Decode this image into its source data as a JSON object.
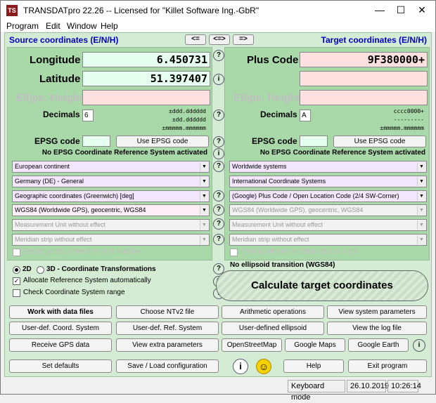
{
  "window": {
    "icon_text": "TS",
    "title": "TRANSDATpro 22.26 -- Licensed for \"Killet Software Ing.-GbR\"",
    "minimize": "—",
    "maximize": "☐",
    "close": "✕"
  },
  "menu": [
    "Program",
    "Edit",
    "Window",
    "Help"
  ],
  "headers": {
    "source": "Source coordinates (E/N/H)",
    "target": "Target coordinates (E/N/H)",
    "arrow_left": "<=",
    "arrow_both": "<=>",
    "arrow_right": "=>"
  },
  "source": {
    "longitude_label": "Longitude",
    "longitude_value": "6.450731",
    "latitude_label": "Latitude",
    "latitude_value": "51.397407",
    "ellips_label": "Ellips. Height",
    "ellips_value": "",
    "decimals_label": "Decimals",
    "decimals_value": "6",
    "format_line1": "±ddd.dddddd",
    "format_line2": "±dd.dddddd",
    "format_line3": "±mmmmm.mmmmmm",
    "epsg_label": "EPSG code",
    "epsg_button": "Use EPSG code",
    "epsg_status": "No EPSG Coordinate Reference System activated",
    "combos": [
      "European continent",
      "Germany (DE) - General",
      "Geographic coordinates (Greenwich) [deg]",
      "WGS84 (Worldwide GPS), geocentric, WGS84",
      "Measurement Unit without effect",
      "Meridian strip without effect"
    ],
    "easting_label": "Easting without meridian strip number"
  },
  "target": {
    "pluscode_label": "Plus Code",
    "pluscode_value": "9F380000+",
    "ellips_label": "Ellips. Height",
    "decimals_label": "Decimals",
    "decimals_value": "A",
    "format_line1": "cccc0000+",
    "format_line2": "---------",
    "format_line3": "±mmmmm.mmmmmm",
    "epsg_label": "EPSG code",
    "epsg_button": "Use EPSG code",
    "epsg_status": "No EPSG Coordinate Reference System activated",
    "combos": [
      "Worldwide systems",
      "International Coordinate Systems",
      "(Google) Plus Code / Open Location Code (2/4 SW-Corner)",
      "WGS84 (Worldwide GPS), geocentric, WGS84",
      "Measurement Unit without effect",
      "Meridian strip without effect"
    ],
    "easting_label": "Easting without meridian strip number"
  },
  "options": {
    "radio_2d": "2D",
    "radio_3d": "3D - Coordinate Transformations",
    "allocate": "Allocate Reference System automatically",
    "check_range": "Check Coordinate System range",
    "ellipsoid_note": "No ellipsoid transition (WGS84)",
    "calc_button": "Calculate target coordinates"
  },
  "buttons": {
    "work_files": "Work with data files",
    "ntv2": "Choose NTv2 file",
    "arith": "Arithmetic operations",
    "view_sys": "View system parameters",
    "user_coord": "User-def. Coord. System",
    "user_ref": "User-def. Ref. System",
    "user_ellipsoid": "User-defined ellipsoid",
    "view_log": "View the log file",
    "gps": "Receive GPS data",
    "extra": "View extra parameters",
    "osm": "OpenStreetMap",
    "gmaps": "Google Maps",
    "gearth": "Google Earth",
    "info": "i",
    "defaults": "Set defaults",
    "save_load": "Save / Load configuration",
    "help": "Help",
    "exit": "Exit program",
    "question": "?"
  },
  "status": {
    "mode": "Keyboard mode",
    "date": "26.10.2019",
    "time": "10:26:14"
  },
  "colors": {
    "client_bg": "#d4ecd4",
    "panel_bg": "#a9d8a9",
    "header_blue": "#0000c0"
  }
}
